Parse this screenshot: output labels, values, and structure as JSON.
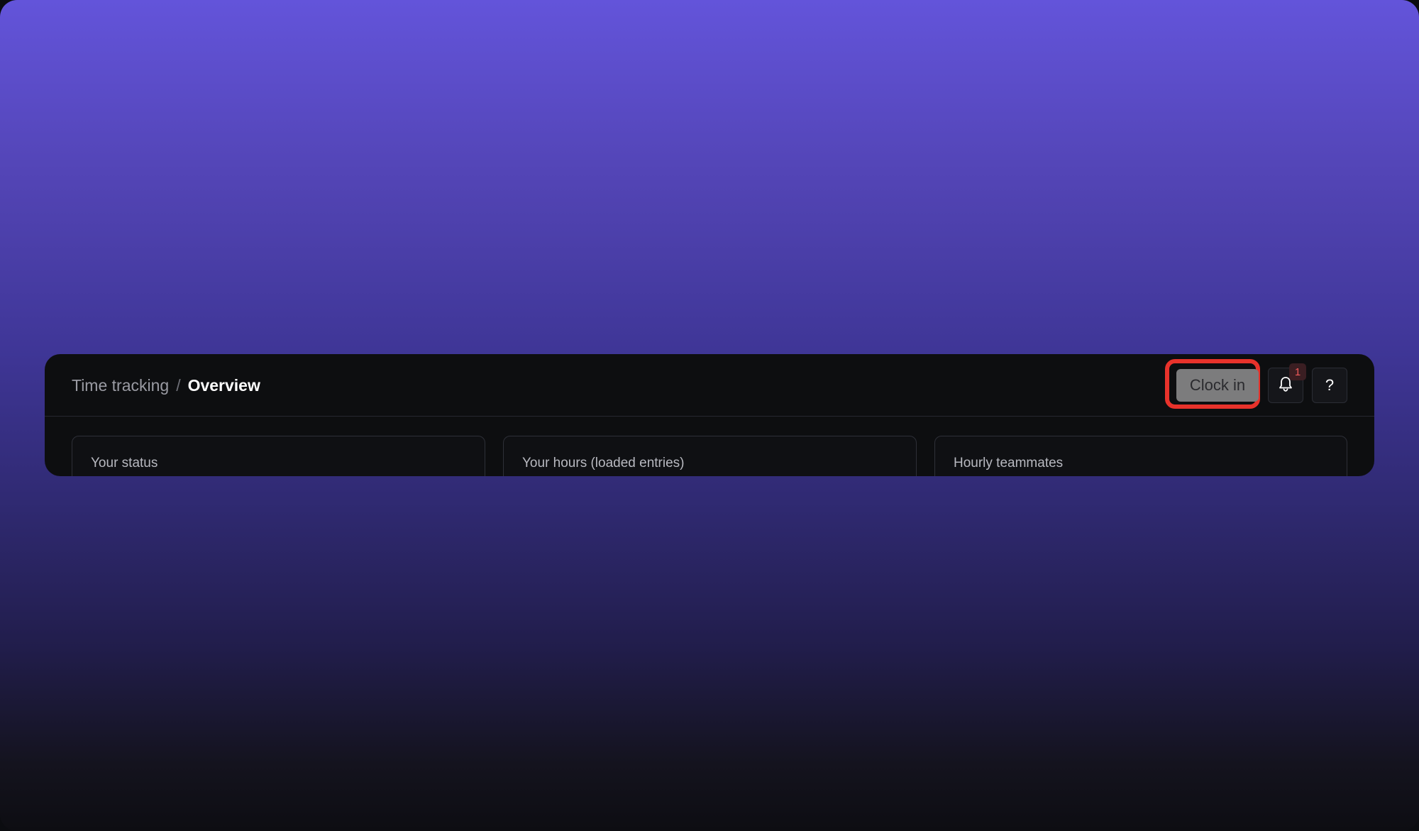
{
  "breadcrumb": {
    "parent": "Time tracking",
    "separator": "/",
    "current": "Overview"
  },
  "header": {
    "clock_in_label": "Clock in",
    "notification_count": "1",
    "help_label": "?",
    "highlight_color": "#e8322b"
  },
  "cards": [
    {
      "title": "Your status"
    },
    {
      "title": "Your hours (loaded entries)"
    },
    {
      "title": "Hourly teammates"
    }
  ],
  "colors": {
    "background_top": "#6354da",
    "background_bottom": "#0d0d12",
    "panel": "#0d0e10",
    "badge_text": "#ef5a5a"
  },
  "icons": {
    "notifications": "bell-icon"
  }
}
